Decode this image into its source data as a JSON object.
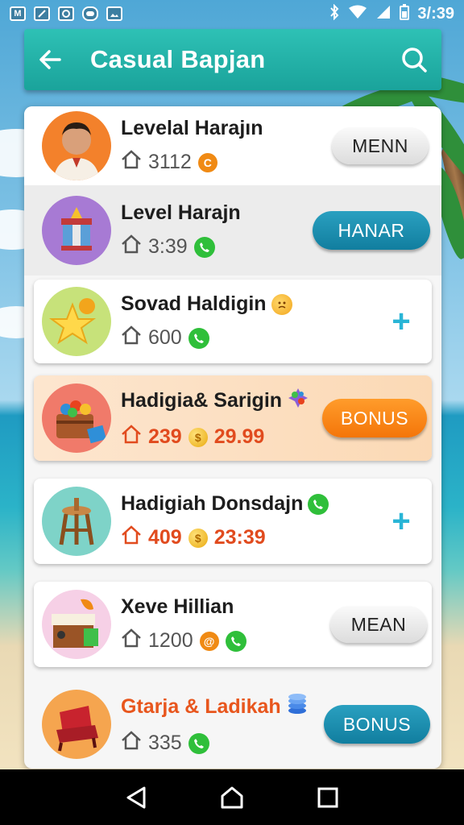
{
  "status_bar": {
    "time": "3/:39",
    "left_icons": [
      "M",
      "tap",
      "sync",
      "message",
      "image"
    ]
  },
  "app_bar": {
    "title": "Casual Bapjan"
  },
  "rows": [
    {
      "title": "Levelal Harajın",
      "value": "3112",
      "value_icon": "coin-c-icon",
      "button": "MENN"
    },
    {
      "title": "Level Harajn",
      "value": "3:39",
      "value_icon": "phone-icon",
      "button": "HANAR"
    },
    {
      "title": "Sovad Haldigin",
      "title_icon": "sad-face-icon",
      "value": "600",
      "value_icon": "phone-icon",
      "button": "+"
    },
    {
      "title": "Hadigia& Sarigin",
      "title_icon": "gems-icon",
      "value": "239",
      "value2": "29.99",
      "button": "BONUS"
    },
    {
      "title": "Hadigiah Donsdajn",
      "title_icon": "phone-icon",
      "value": "409",
      "value2": "23:39",
      "button": "+"
    },
    {
      "title": "Xeve Hillian",
      "value": "1200",
      "value_icon": "at-icon",
      "button": "MEAN"
    },
    {
      "title": "Gtarja & Ladikah",
      "title_icon": "coins-stack-icon",
      "value": "335",
      "value_icon": "phone-icon",
      "button": "BONUS"
    }
  ],
  "colors": {
    "app_bar": "#21b3aa",
    "teal_button": "#1a8fb0",
    "orange_button": "#f58511",
    "plus": "#29b5d6"
  }
}
